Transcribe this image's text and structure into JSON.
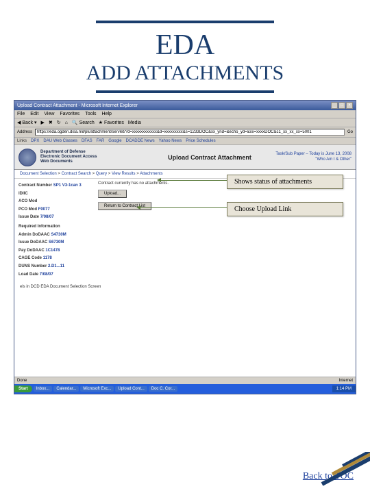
{
  "slide": {
    "title1": "EDA",
    "title2": "ADD ATTACHMENTS",
    "backlink": "Back to TOC"
  },
  "browser": {
    "window_title": "Upload Contract Attachment - Microsoft Internet Explorer",
    "menu": [
      "File",
      "Edit",
      "View",
      "Favorites",
      "Tools",
      "Help"
    ],
    "toolbar": {
      "back": "Back",
      "search": "Search",
      "favorites": "Favorites",
      "media": "Media"
    },
    "address_label": "Address",
    "address_url": "https://eda.ogden.disa.mil/pk/attachment/servlet/?d=xxxxxxxxxxxx&d=xxxxxxxxx&s=1233DOC&xx_ynd=&echo_yd=&xx=xxxxDOC&c1_xx_xx_xx=5001",
    "go": "Go",
    "links_label": "Links",
    "links": [
      "DPX",
      "DAU Web Classes",
      "DFAS",
      "FAR",
      "Google",
      "DCADDE News",
      "Yahoo News",
      "Price Schedules"
    ]
  },
  "header": {
    "org1": "Department of Defense",
    "org2": "Electronic Document Access",
    "org3": "Web Documents",
    "page_title": "Upload Contract Attachment",
    "badge": "Task/Sub Paper – Today is June 13, 2008",
    "whois": "\"Who Am I & Other\""
  },
  "breadcrumb": {
    "parts": [
      "Document Selection",
      "Contract Search",
      "Query",
      "View Results",
      "Attachments"
    ]
  },
  "contract": {
    "heading": "Contract Number",
    "number": "SP1 V3-1can 3",
    "fields": [
      {
        "label": "IDIIC",
        "value": ""
      },
      {
        "label": "ACO Mod",
        "value": ""
      },
      {
        "label": "PCO Mod",
        "value": "F0077"
      },
      {
        "label": "Issue Date",
        "value": "7/08/07"
      }
    ],
    "reqhead": "Required Information",
    "reqfields": [
      {
        "label": "Admin DoDAAC",
        "value": "S4730M"
      },
      {
        "label": "Issue DoDAAC",
        "value": "S6730M"
      },
      {
        "label": "Pay DoDAAC",
        "value": "1C1478"
      },
      {
        "label": "CAGE Code",
        "value": "1178"
      },
      {
        "label": "DUNS Number",
        "value": "2.D1...11"
      },
      {
        "label": "Load Date",
        "value": "7/08/07"
      }
    ]
  },
  "mid": {
    "status_msg": "Contract currently has no attachments.",
    "upload_btn": "Upload...",
    "return_btn": "Return to Contract List"
  },
  "callouts": {
    "status": "Shows status of attachments",
    "upload": "Choose Upload Link"
  },
  "footer_note": "els in DCD EDA Document Selection Screen",
  "statusbar": {
    "left": "Done",
    "right": "Internet"
  },
  "taskbar": {
    "start": "Start",
    "items": [
      "Inbox...",
      "Calendar...",
      "Microsoft Exc...",
      "Upload Cont...",
      "Doc C. Cor..."
    ],
    "tray": "1:14 PM"
  }
}
